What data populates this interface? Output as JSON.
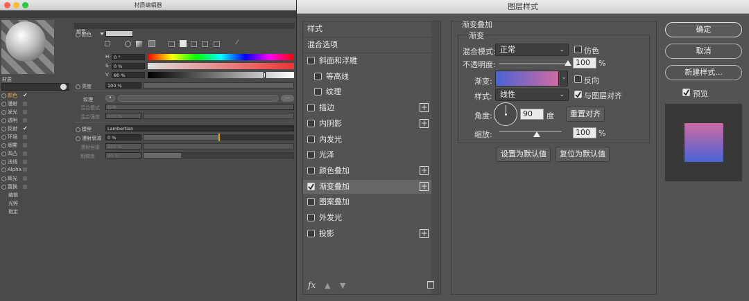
{
  "left": {
    "title": "材质编辑器",
    "material_label": "材质",
    "section_color": "颜色",
    "color_label": "颜色",
    "hsv": [
      {
        "label": "H",
        "value": "0 °"
      },
      {
        "label": "S",
        "value": "0 %"
      },
      {
        "label": "V",
        "value": "80 %"
      }
    ],
    "brightness_label": "亮度",
    "brightness_value": "100 %",
    "texture_label": "纹理",
    "texture_dots": "...",
    "mix_mode_label": "混合模式",
    "mix_mode_value": "标准",
    "mix_strength_label": "混合强度",
    "mix_strength_value": "100 %",
    "model_label": "模型",
    "model_value": "Lambertian",
    "diffuse_falloff_label": "漫射衰减",
    "diffuse_falloff_value": "0 %",
    "diffuse_level_label": "漫射层级",
    "diffuse_level_value": "100 %",
    "roughness_label": "粗糙度",
    "roughness_value": "50 %",
    "channels": [
      {
        "label": "颜色",
        "checked": true,
        "active": true
      },
      {
        "label": "漫射",
        "checked": false
      },
      {
        "label": "发光",
        "checked": false
      },
      {
        "label": "透明",
        "checked": false
      },
      {
        "label": "反射",
        "checked": true
      },
      {
        "label": "环境",
        "checked": false
      },
      {
        "label": "烟雾",
        "checked": false
      },
      {
        "label": "凹凸",
        "checked": false
      },
      {
        "label": "法线",
        "checked": false
      },
      {
        "label": "Alpha",
        "checked": false
      },
      {
        "label": "辉光",
        "checked": false
      },
      {
        "label": "置换",
        "checked": false
      }
    ],
    "extras": [
      "编辑",
      "光照",
      "指定"
    ]
  },
  "right": {
    "title": "图层样式",
    "styles_header": "样式",
    "blend_options": "混合选项",
    "items": [
      {
        "label": "斜面和浮雕",
        "checked": false,
        "plus": false,
        "indent": false
      },
      {
        "label": "等高线",
        "checked": false,
        "plus": false,
        "indent": true
      },
      {
        "label": "纹理",
        "checked": false,
        "plus": false,
        "indent": true
      },
      {
        "label": "描边",
        "checked": false,
        "plus": true,
        "indent": false
      },
      {
        "label": "内阴影",
        "checked": false,
        "plus": true,
        "indent": false
      },
      {
        "label": "内发光",
        "checked": false,
        "plus": false,
        "indent": false
      },
      {
        "label": "光泽",
        "checked": false,
        "plus": false,
        "indent": false
      },
      {
        "label": "颜色叠加",
        "checked": false,
        "plus": true,
        "indent": false
      },
      {
        "label": "渐变叠加",
        "checked": true,
        "plus": true,
        "indent": false,
        "selected": true
      },
      {
        "label": "图案叠加",
        "checked": false,
        "plus": false,
        "indent": false
      },
      {
        "label": "外发光",
        "checked": false,
        "plus": false,
        "indent": false
      },
      {
        "label": "投影",
        "checked": false,
        "plus": true,
        "indent": false
      }
    ],
    "fx_label": "fx",
    "section_title": "渐变叠加",
    "group_title": "渐变",
    "blend_mode_label": "混合模式:",
    "blend_mode_value": "正常",
    "dither_label": "仿色",
    "opacity_label": "不透明度:",
    "opacity_value": "100",
    "opacity_fraction": 1.0,
    "percent": "%",
    "gradient_label": "渐变:",
    "reverse_label": "反向",
    "style_label": "样式:",
    "style_value": "线性",
    "align_label": "与图层对齐",
    "angle_label": "角度:",
    "angle_value": "90",
    "degree": "度",
    "reset_align": "重置对齐",
    "scale_label": "缩放:",
    "scale_value": "100",
    "scale_fraction": 0.6,
    "set_default": "设置为默认值",
    "reset_default": "复位为默认值",
    "ok": "确定",
    "cancel": "取消",
    "new_style": "新建样式...",
    "preview_label": "预览",
    "colors": {
      "gradient_start": "#4a63d6",
      "gradient_end": "#cf6aa3"
    }
  }
}
